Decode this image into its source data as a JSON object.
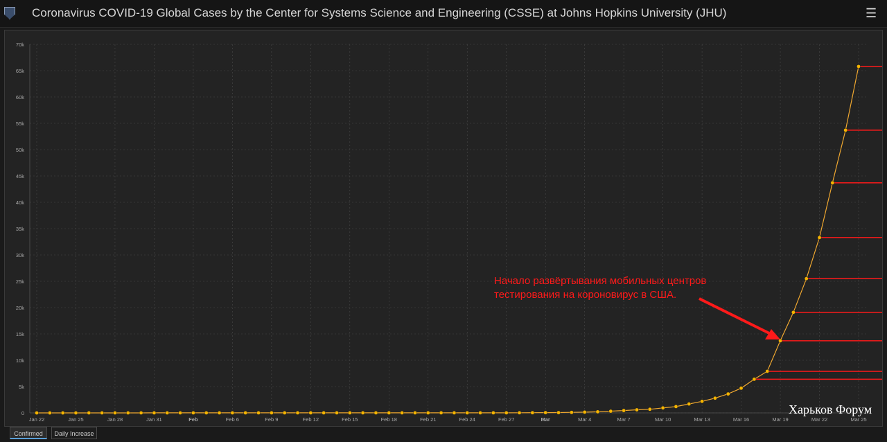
{
  "header": {
    "title": "Coronavirus COVID-19 Global Cases by the Center for Systems Science and Engineering (CSSE) at Johns Hopkins University (JHU)",
    "menu_icon": "hamburger-icon"
  },
  "tabs": [
    {
      "label": "Confirmed",
      "active": true
    },
    {
      "label": "Daily Increase",
      "active": false
    }
  ],
  "colors": {
    "line": "#f0a830",
    "point": "#f5b400",
    "annotation": "#ff1a1a",
    "grid": "#4a4a4a",
    "background": "#232323"
  },
  "annotation": {
    "text_line1": "Начало развёртывания мобильных центров",
    "text_line2": "тестирования на короновирус в США.",
    "points_to": "Mar 19"
  },
  "watermark": "Харьков Форум",
  "chart_data": {
    "type": "line",
    "ylim": [
      0,
      70000
    ],
    "y_ticks": [
      "0",
      "5k",
      "10k",
      "15k",
      "20k",
      "25k",
      "30k",
      "35k",
      "40k",
      "45k",
      "50k",
      "55k",
      "60k",
      "65k",
      "70k"
    ],
    "x_ticks": [
      {
        "label": "Jan 22",
        "bold": false
      },
      {
        "label": "Jan 25",
        "bold": false
      },
      {
        "label": "Jan 28",
        "bold": false
      },
      {
        "label": "Jan 31",
        "bold": false
      },
      {
        "label": "Feb",
        "bold": true
      },
      {
        "label": "Feb 6",
        "bold": false
      },
      {
        "label": "Feb 9",
        "bold": false
      },
      {
        "label": "Feb 12",
        "bold": false
      },
      {
        "label": "Feb 15",
        "bold": false
      },
      {
        "label": "Feb 18",
        "bold": false
      },
      {
        "label": "Feb 21",
        "bold": false
      },
      {
        "label": "Feb 24",
        "bold": false
      },
      {
        "label": "Feb 27",
        "bold": false
      },
      {
        "label": "Mar",
        "bold": true
      },
      {
        "label": "Mar 4",
        "bold": false
      },
      {
        "label": "Mar 7",
        "bold": false
      },
      {
        "label": "Mar 10",
        "bold": false
      },
      {
        "label": "Mar 13",
        "bold": false
      },
      {
        "label": "Mar 16",
        "bold": false
      },
      {
        "label": "Mar 19",
        "bold": false
      },
      {
        "label": "Mar 22",
        "bold": false
      },
      {
        "label": "Mar 25",
        "bold": false
      }
    ],
    "x_start": "2020-01-22",
    "series": [
      {
        "values": [
          1,
          1,
          2,
          2,
          5,
          5,
          5,
          5,
          5,
          7,
          8,
          8,
          11,
          11,
          11,
          11,
          12,
          12,
          13,
          13,
          13,
          13,
          13,
          13,
          13,
          13,
          13,
          13,
          13,
          13,
          14,
          14,
          15,
          15,
          15,
          16,
          18,
          25,
          35,
          57,
          60,
          100,
          145,
          213,
          324,
          453,
          590,
          690,
          950,
          1200,
          1700,
          2200,
          2800,
          3600,
          4700,
          6400,
          7900,
          13700,
          19100,
          25500,
          33300,
          43700,
          53700,
          65800
        ],
        "hlines_from": "Mar 17"
      }
    ]
  }
}
